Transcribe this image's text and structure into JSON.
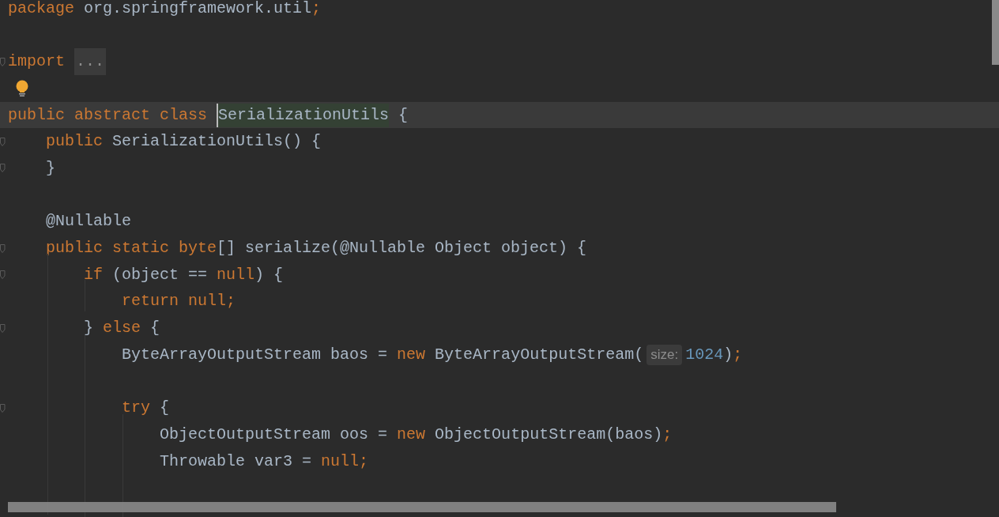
{
  "editor": {
    "lines": [
      {
        "current": false,
        "fold_marker": false,
        "bulb": false,
        "segments": [
          {
            "kind": "code",
            "tokens": [
              {
                "kind": "keyword",
                "text": "package "
              },
              {
                "kind": "plain",
                "text": "org.springframework.util"
              },
              {
                "kind": "keyword",
                "text": ";"
              }
            ]
          }
        ]
      },
      {
        "current": false,
        "fold_marker": false,
        "bulb": false
      },
      {
        "current": false,
        "fold_marker": true,
        "bulb": false,
        "segments": [
          {
            "kind": "code",
            "tokens": [
              {
                "kind": "keyword",
                "text": "import"
              }
            ]
          },
          {
            "kind": "fold",
            "text": "..."
          }
        ]
      },
      {
        "current": false,
        "fold_marker": false,
        "bulb": true
      },
      {
        "current": true,
        "fold_marker": false,
        "bulb": false,
        "segments": [
          {
            "kind": "code",
            "tokens": [
              {
                "kind": "keyword",
                "text": "public abstract class "
              }
            ]
          },
          {
            "kind": "usage",
            "text": "SerializationUtils"
          },
          {
            "kind": "code",
            "tokens": [
              {
                "kind": "plain",
                "text": " {"
              }
            ]
          }
        ]
      },
      {
        "current": false,
        "fold_marker": true,
        "bulb": false,
        "segments": [
          {
            "kind": "code",
            "tokens": [
              {
                "kind": "keyword",
                "text": "    public "
              },
              {
                "kind": "plain",
                "text": "SerializationUtils() {"
              }
            ]
          }
        ]
      },
      {
        "current": false,
        "fold_marker": true,
        "bulb": false,
        "segments": [
          {
            "kind": "code",
            "tokens": [
              {
                "kind": "plain",
                "text": "    }"
              }
            ]
          }
        ]
      },
      {
        "current": false,
        "fold_marker": false,
        "bulb": false
      },
      {
        "current": false,
        "fold_marker": false,
        "bulb": false,
        "segments": [
          {
            "kind": "code",
            "tokens": [
              {
                "kind": "plain",
                "text": "    @Nullable"
              }
            ]
          }
        ]
      },
      {
        "current": false,
        "fold_marker": true,
        "bulb": false,
        "segments": [
          {
            "kind": "code",
            "tokens": [
              {
                "kind": "keyword",
                "text": "    public static byte"
              },
              {
                "kind": "plain",
                "text": "[] serialize(@Nullable Object object) {"
              }
            ]
          }
        ]
      },
      {
        "current": false,
        "fold_marker": true,
        "bulb": false,
        "segments": [
          {
            "kind": "code",
            "tokens": [
              {
                "kind": "keyword",
                "text": "        if "
              },
              {
                "kind": "plain",
                "text": "(object == "
              },
              {
                "kind": "keyword",
                "text": "null"
              },
              {
                "kind": "plain",
                "text": ") {"
              }
            ]
          }
        ]
      },
      {
        "current": false,
        "fold_marker": false,
        "bulb": false,
        "segments": [
          {
            "kind": "code",
            "tokens": [
              {
                "kind": "keyword",
                "text": "            return null;"
              }
            ]
          }
        ]
      },
      {
        "current": false,
        "fold_marker": true,
        "bulb": false,
        "segments": [
          {
            "kind": "code",
            "tokens": [
              {
                "kind": "plain",
                "text": "        } "
              },
              {
                "kind": "keyword",
                "text": "else "
              },
              {
                "kind": "plain",
                "text": "{"
              }
            ]
          }
        ]
      },
      {
        "current": false,
        "fold_marker": false,
        "bulb": false,
        "segments": [
          {
            "kind": "code",
            "tokens": [
              {
                "kind": "plain",
                "text": "            ByteArrayOutputStream baos = "
              },
              {
                "kind": "keyword",
                "text": "new "
              },
              {
                "kind": "plain",
                "text": "ByteArrayOutputStream("
              }
            ]
          },
          {
            "kind": "hint",
            "text": "size:"
          },
          {
            "kind": "code",
            "tokens": [
              {
                "kind": "number",
                "text": "1024"
              },
              {
                "kind": "plain",
                "text": ")"
              },
              {
                "kind": "keyword",
                "text": ";"
              }
            ]
          }
        ]
      },
      {
        "current": false,
        "fold_marker": false,
        "bulb": false
      },
      {
        "current": false,
        "fold_marker": true,
        "bulb": false,
        "segments": [
          {
            "kind": "code",
            "tokens": [
              {
                "kind": "keyword",
                "text": "            try "
              },
              {
                "kind": "plain",
                "text": "{"
              }
            ]
          }
        ]
      },
      {
        "current": false,
        "fold_marker": false,
        "bulb": false,
        "segments": [
          {
            "kind": "code",
            "tokens": [
              {
                "kind": "plain",
                "text": "                ObjectOutputStream oos = "
              },
              {
                "kind": "keyword",
                "text": "new "
              },
              {
                "kind": "plain",
                "text": "ObjectOutputStream(baos)"
              },
              {
                "kind": "keyword",
                "text": ";"
              }
            ]
          }
        ]
      },
      {
        "current": false,
        "fold_marker": false,
        "bulb": false,
        "segments": [
          {
            "kind": "code",
            "tokens": [
              {
                "kind": "plain",
                "text": "                Throwable var3 = "
              },
              {
                "kind": "keyword",
                "text": "null;"
              }
            ]
          }
        ]
      },
      {
        "current": false,
        "fold_marker": false,
        "bulb": false
      }
    ]
  }
}
